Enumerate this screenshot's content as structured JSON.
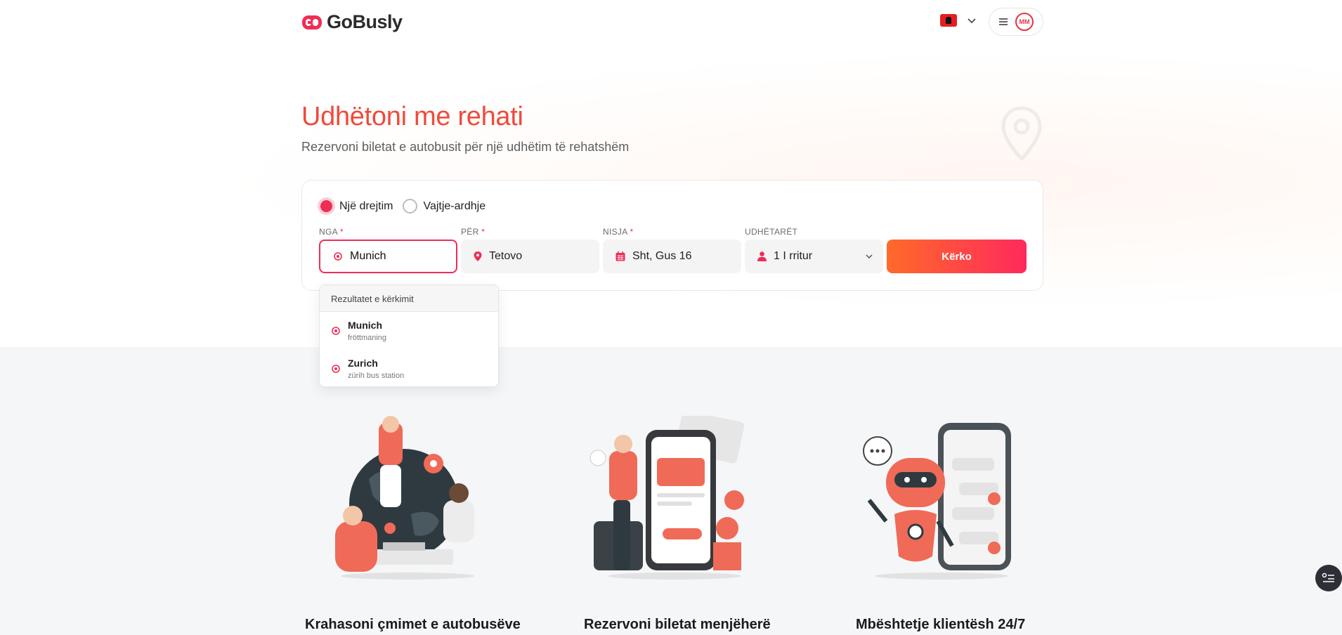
{
  "brand": {
    "name": "GoBusly",
    "accent": "#ef2d56",
    "orange": "#ff6a2a",
    "title_color": "#f04a3a"
  },
  "header": {
    "language_icon": "albania-flag-icon",
    "menu_icon": "hamburger-icon",
    "avatar_text": "MM"
  },
  "hero": {
    "title": "Udhëtoni me rehati",
    "subtitle": "Rezervoni biletat e autobusit për një udhëtim të rehatshëm"
  },
  "search": {
    "trip_types": [
      {
        "label": "Një drejtim",
        "selected": true
      },
      {
        "label": "Vajtje-ardhje",
        "selected": false
      }
    ],
    "from": {
      "label": "NGA",
      "value": "Munich"
    },
    "to": {
      "label": "PËR",
      "value": "Tetovo"
    },
    "date": {
      "label": "NISJA",
      "value": "Sht, Gus 16"
    },
    "passengers": {
      "label": "UDHËTARËT",
      "value": "1 I rritur"
    },
    "required_mark": "*",
    "submit_label": "Kërko"
  },
  "dropdown": {
    "header": "Rezultatet e kërkimit",
    "results": [
      {
        "name": "Munich",
        "station": "fröttmaning"
      },
      {
        "name": "Zurich",
        "station": "zürih bus station"
      }
    ]
  },
  "features": [
    {
      "title": "Krahasoni çmimet e autobusëve",
      "icon": "globe-travelers-illustration"
    },
    {
      "title": "Rezervoni biletat menjëherë",
      "icon": "mobile-payment-illustration"
    },
    {
      "title": "Mbështetje klientësh 24/7",
      "icon": "support-robot-illustration"
    }
  ]
}
